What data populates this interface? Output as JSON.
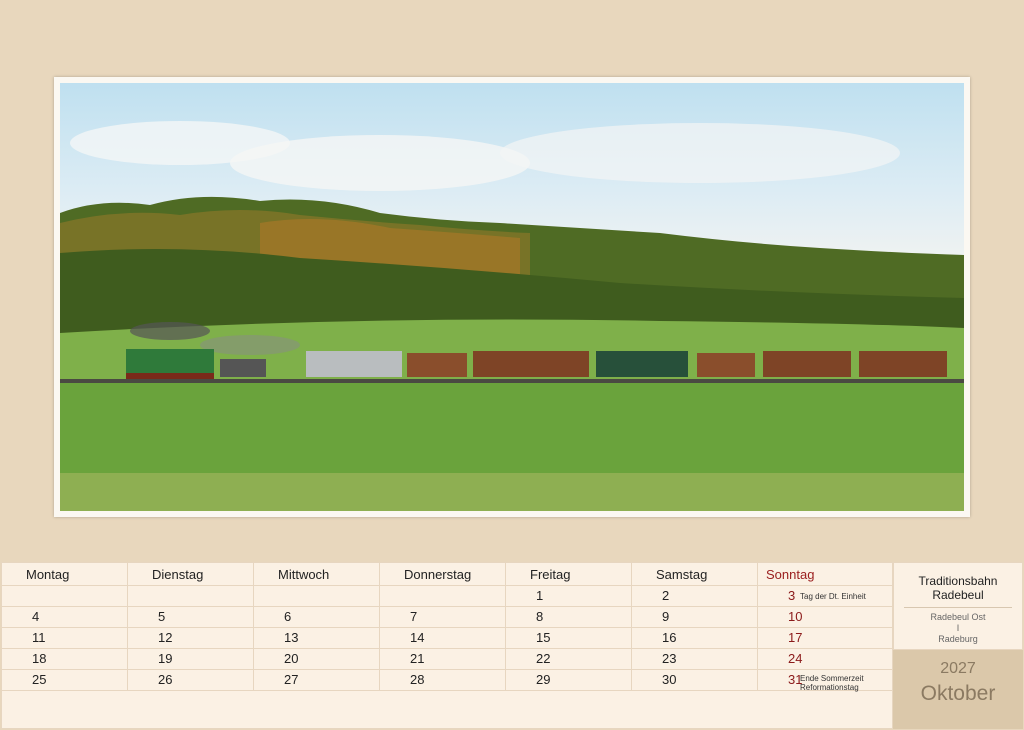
{
  "photo": {
    "description_icon": "train-photo"
  },
  "calendar": {
    "weekdays": [
      "Montag",
      "Dienstag",
      "Mittwoch",
      "Donnerstag",
      "Freitag",
      "Samstag",
      "Sonntag"
    ],
    "weeks": [
      [
        "",
        "",
        "",
        "",
        "1",
        "2",
        "3"
      ],
      [
        "4",
        "5",
        "6",
        "7",
        "8",
        "9",
        "10"
      ],
      [
        "11",
        "12",
        "13",
        "14",
        "15",
        "16",
        "17"
      ],
      [
        "18",
        "19",
        "20",
        "21",
        "22",
        "23",
        "24"
      ],
      [
        "25",
        "26",
        "27",
        "28",
        "29",
        "30",
        "31"
      ]
    ],
    "holidays": {
      "d3": "Tag der Dt. Einheit",
      "d31_line1": "Ende Sommerzeit",
      "d31_line2": "Reformationstag"
    }
  },
  "side": {
    "title_line1": "Traditionsbahn",
    "title_line2": "Radebeul",
    "route_from": "Radebeul Ost",
    "route_sep": "I",
    "route_to": "Radeburg",
    "year": "2027",
    "month": "Oktober"
  },
  "colors": {
    "background": "#e8d7bd",
    "sunday": "#8b1a1a",
    "month_text": "#8b7a62"
  }
}
